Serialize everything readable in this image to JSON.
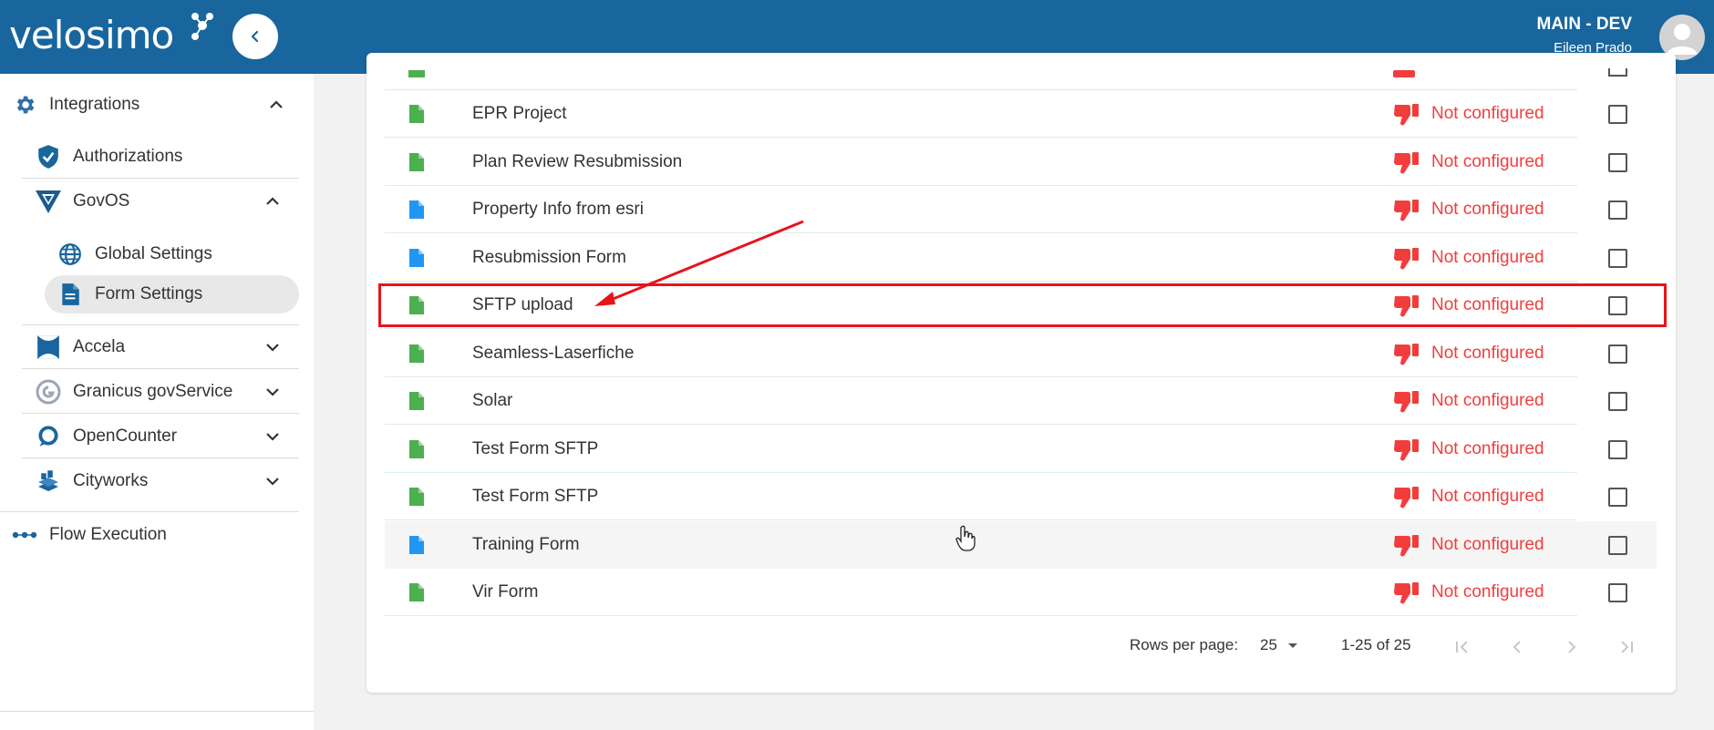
{
  "header": {
    "logo_text": "velosimo",
    "environment": "MAIN - DEV",
    "user_name": "Eileen Prado",
    "brand_color": "#18669d"
  },
  "sidebar": {
    "integrations": {
      "label": "Integrations",
      "icon": "gear-icon"
    },
    "authorizations": {
      "label": "Authorizations",
      "icon": "shield-check-icon"
    },
    "govos": {
      "label": "GovOS",
      "icon": "govos-logo-icon"
    },
    "global_settings": {
      "label": "Global Settings",
      "icon": "globe-icon"
    },
    "form_settings": {
      "label": "Form Settings",
      "icon": "document-icon"
    },
    "accela": {
      "label": "Accela",
      "icon": "accela-logo-icon"
    },
    "granicus": {
      "label": "Granicus govService",
      "icon": "granicus-logo-icon"
    },
    "opencounter": {
      "label": "OpenCounter",
      "icon": "opencounter-logo-icon"
    },
    "cityworks": {
      "label": "Cityworks",
      "icon": "cityworks-logo-icon"
    },
    "flow_execution": {
      "label": "Flow Execution",
      "icon": "flow-dots-icon"
    }
  },
  "forms": [
    {
      "name": "EPR Project",
      "status": "Not configured",
      "file_color": "#4caf50"
    },
    {
      "name": "Plan Review Resubmission",
      "status": "Not configured",
      "file_color": "#4caf50"
    },
    {
      "name": "Property Info from esri",
      "status": "Not configured",
      "file_color": "#2196f3"
    },
    {
      "name": "Resubmission Form",
      "status": "Not configured",
      "file_color": "#2196f3"
    },
    {
      "name": "SFTP upload",
      "status": "Not configured",
      "file_color": "#4caf50"
    },
    {
      "name": "Seamless-Laserfiche",
      "status": "Not configured",
      "file_color": "#4caf50"
    },
    {
      "name": "Solar",
      "status": "Not configured",
      "file_color": "#4caf50"
    },
    {
      "name": "Test Form SFTP",
      "status": "Not configured",
      "file_color": "#4caf50"
    },
    {
      "name": "Test Form SFTP",
      "status": "Not configured",
      "file_color": "#4caf50"
    },
    {
      "name": "Training Form",
      "status": "Not configured",
      "file_color": "#2196f3"
    },
    {
      "name": "Vir Form",
      "status": "Not configured",
      "file_color": "#4caf50"
    }
  ],
  "pagination": {
    "rows_per_page_label": "Rows per page:",
    "rows_per_page_value": "25",
    "range": "1-25 of 25"
  },
  "colors": {
    "status_red": "#f23d3d",
    "highlight_red": "#e8141b",
    "file_green": "#4caf50",
    "file_blue": "#2196f3"
  }
}
